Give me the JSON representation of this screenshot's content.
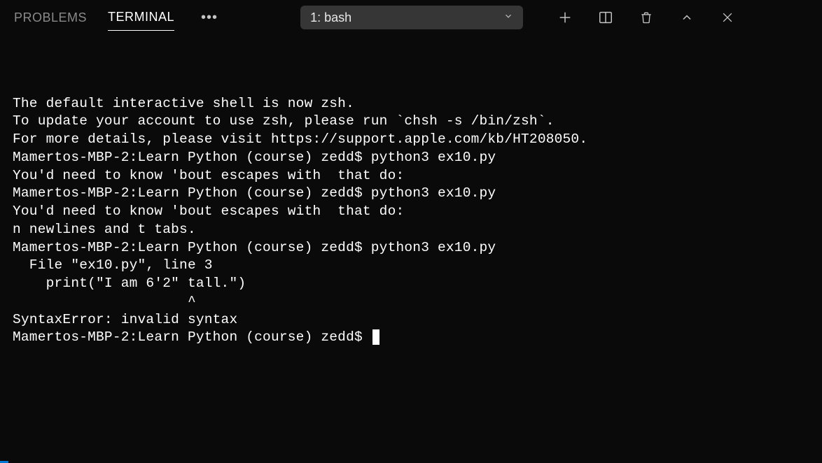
{
  "tabs": {
    "problems": "PROBLEMS",
    "terminal": "TERMINAL"
  },
  "dropdown": {
    "label": "1: bash"
  },
  "terminal": {
    "lines": [
      "",
      "The default interactive shell is now zsh.",
      "To update your account to use zsh, please run `chsh -s /bin/zsh`.",
      "For more details, please visit https://support.apple.com/kb/HT208050.",
      "Mamertos-MBP-2:Learn Python (course) zedd$ python3 ex10.py",
      "You'd need to know 'bout escapes with  that do:",
      "Mamertos-MBP-2:Learn Python (course) zedd$ python3 ex10.py",
      "You'd need to know 'bout escapes with  that do:",
      "n newlines and t tabs.",
      "Mamertos-MBP-2:Learn Python (course) zedd$ python3 ex10.py",
      "  File \"ex10.py\", line 3",
      "    print(\"I am 6'2\" tall.\")",
      "                     ^",
      "SyntaxError: invalid syntax"
    ],
    "prompt": "Mamertos-MBP-2:Learn Python (course) zedd$ "
  }
}
